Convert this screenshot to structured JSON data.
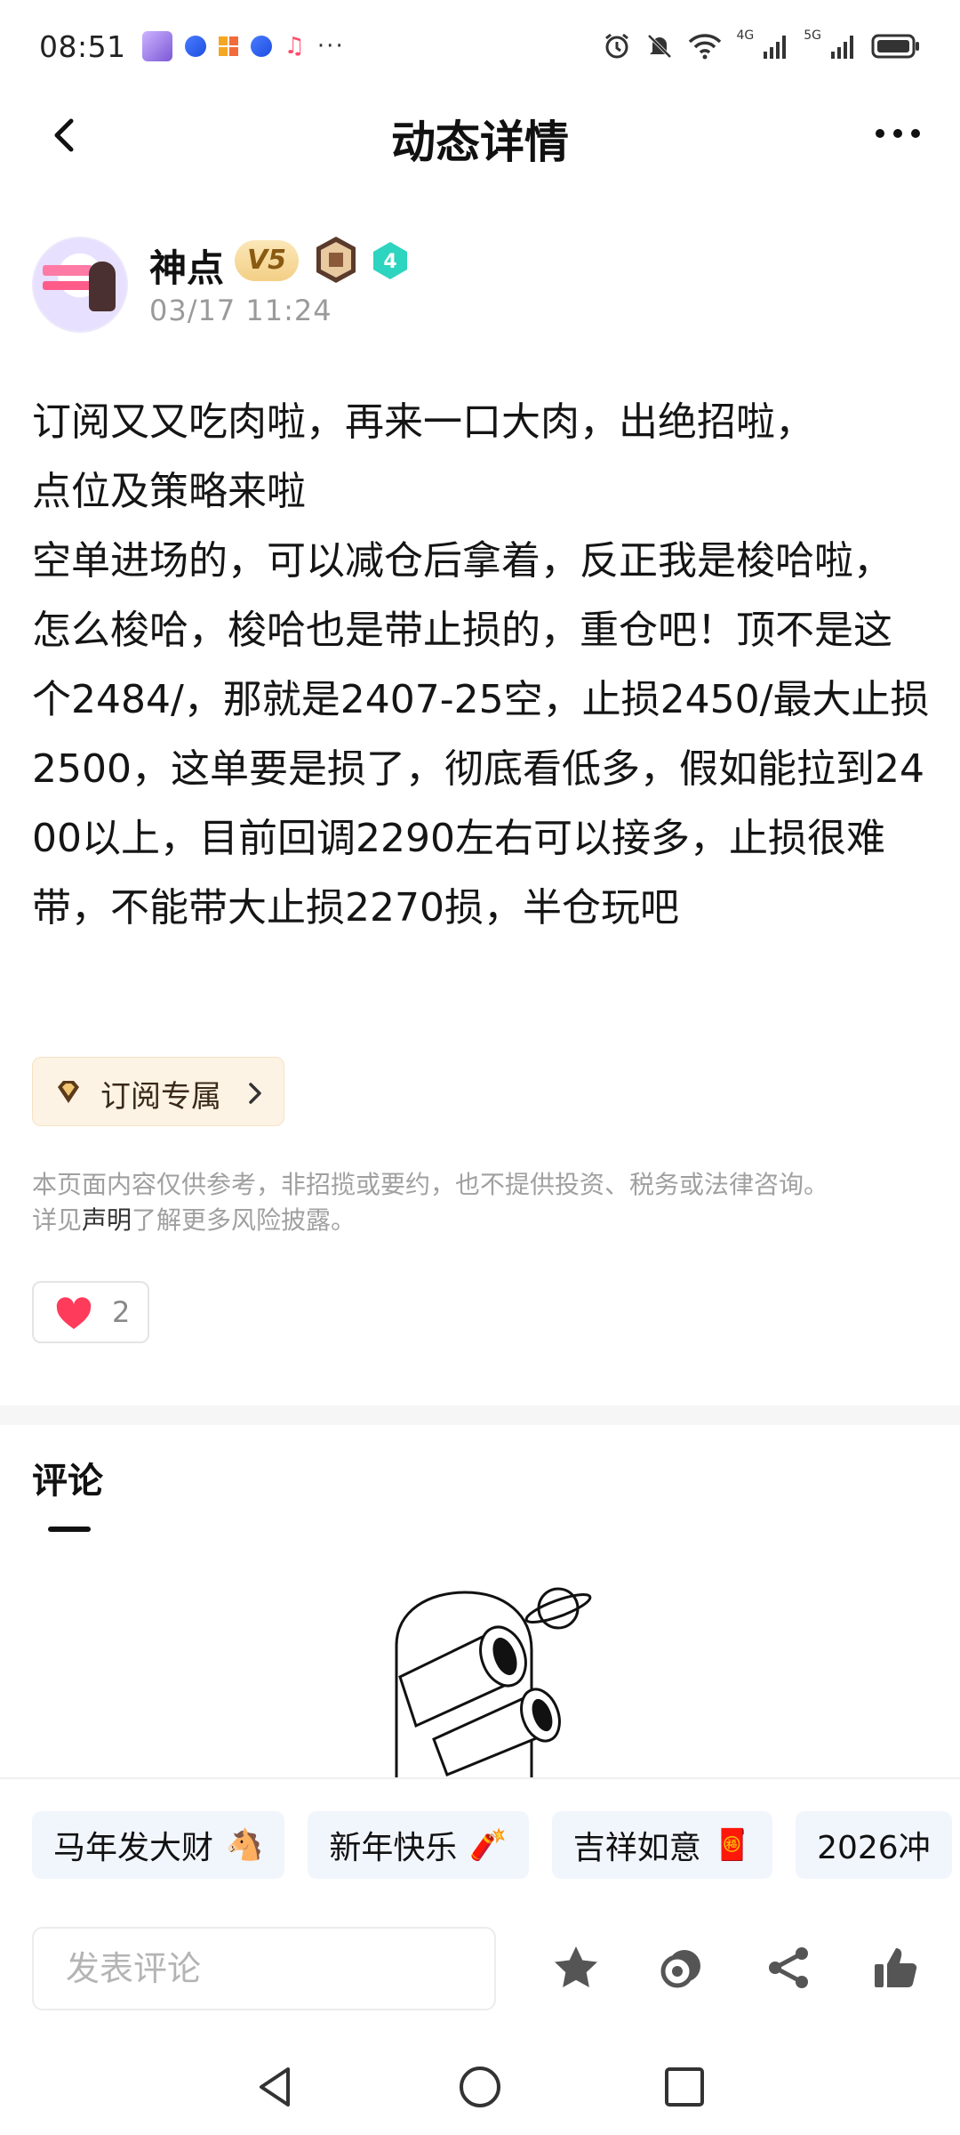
{
  "status_bar": {
    "time": "08:51",
    "net_4g": "4G",
    "net_5g": "5G",
    "more": "···"
  },
  "header": {
    "title": "动态详情"
  },
  "author": {
    "name": "神点",
    "vip_badge": "V5",
    "level_badge": "4",
    "time": "03/17 11:24"
  },
  "post": {
    "content": "订阅又又吃肉啦，再来一口大肉，出绝招啦，\n点位及策略来啦\n空单进场的，可以减仓后拿着，反正我是梭哈啦，怎么梭哈，梭哈也是带止损的，重仓吧！顶不是这个2484/，那就是2407-25空，止损2450/最大止损2500，这单要是损了，彻底看低多，假如能拉到2400以上，目前回调2290左右可以接多，止损很难带，不能带大止损2270损，半仓玩吧"
  },
  "subscription_chip": {
    "label": "订阅专属"
  },
  "disclaimer": {
    "line1": "本页面内容仅供参考，非招揽或要约，也不提供投资、税务或法律咨询。",
    "prefix": "详见",
    "link": "声明",
    "suffix": "了解更多风险披露。"
  },
  "like": {
    "count": "2"
  },
  "comments": {
    "title": "评论"
  },
  "quick_replies": [
    {
      "text": "马年发大财",
      "emoji": "🐴"
    },
    {
      "text": "新年快乐",
      "emoji": "🧨"
    },
    {
      "text": "吉祥如意",
      "emoji": "🧧"
    },
    {
      "text": "2026冲",
      "emoji": ""
    }
  ],
  "bottom_bar": {
    "comment_placeholder": "发表评论"
  },
  "colors": {
    "vip_gold": "#f3cf86",
    "level_teal": "#2dd4bf",
    "heart_red": "#ff3b5c",
    "chip_bg": "#f1f6fd",
    "sub_chip_bg": "#fdf3e4"
  },
  "icons": [
    "back-arrow-icon",
    "more-dots-icon",
    "diamond-icon",
    "chevron-right-icon",
    "heart-icon",
    "star-icon",
    "coin-icon",
    "share-icon",
    "thumbs-up-icon"
  ]
}
